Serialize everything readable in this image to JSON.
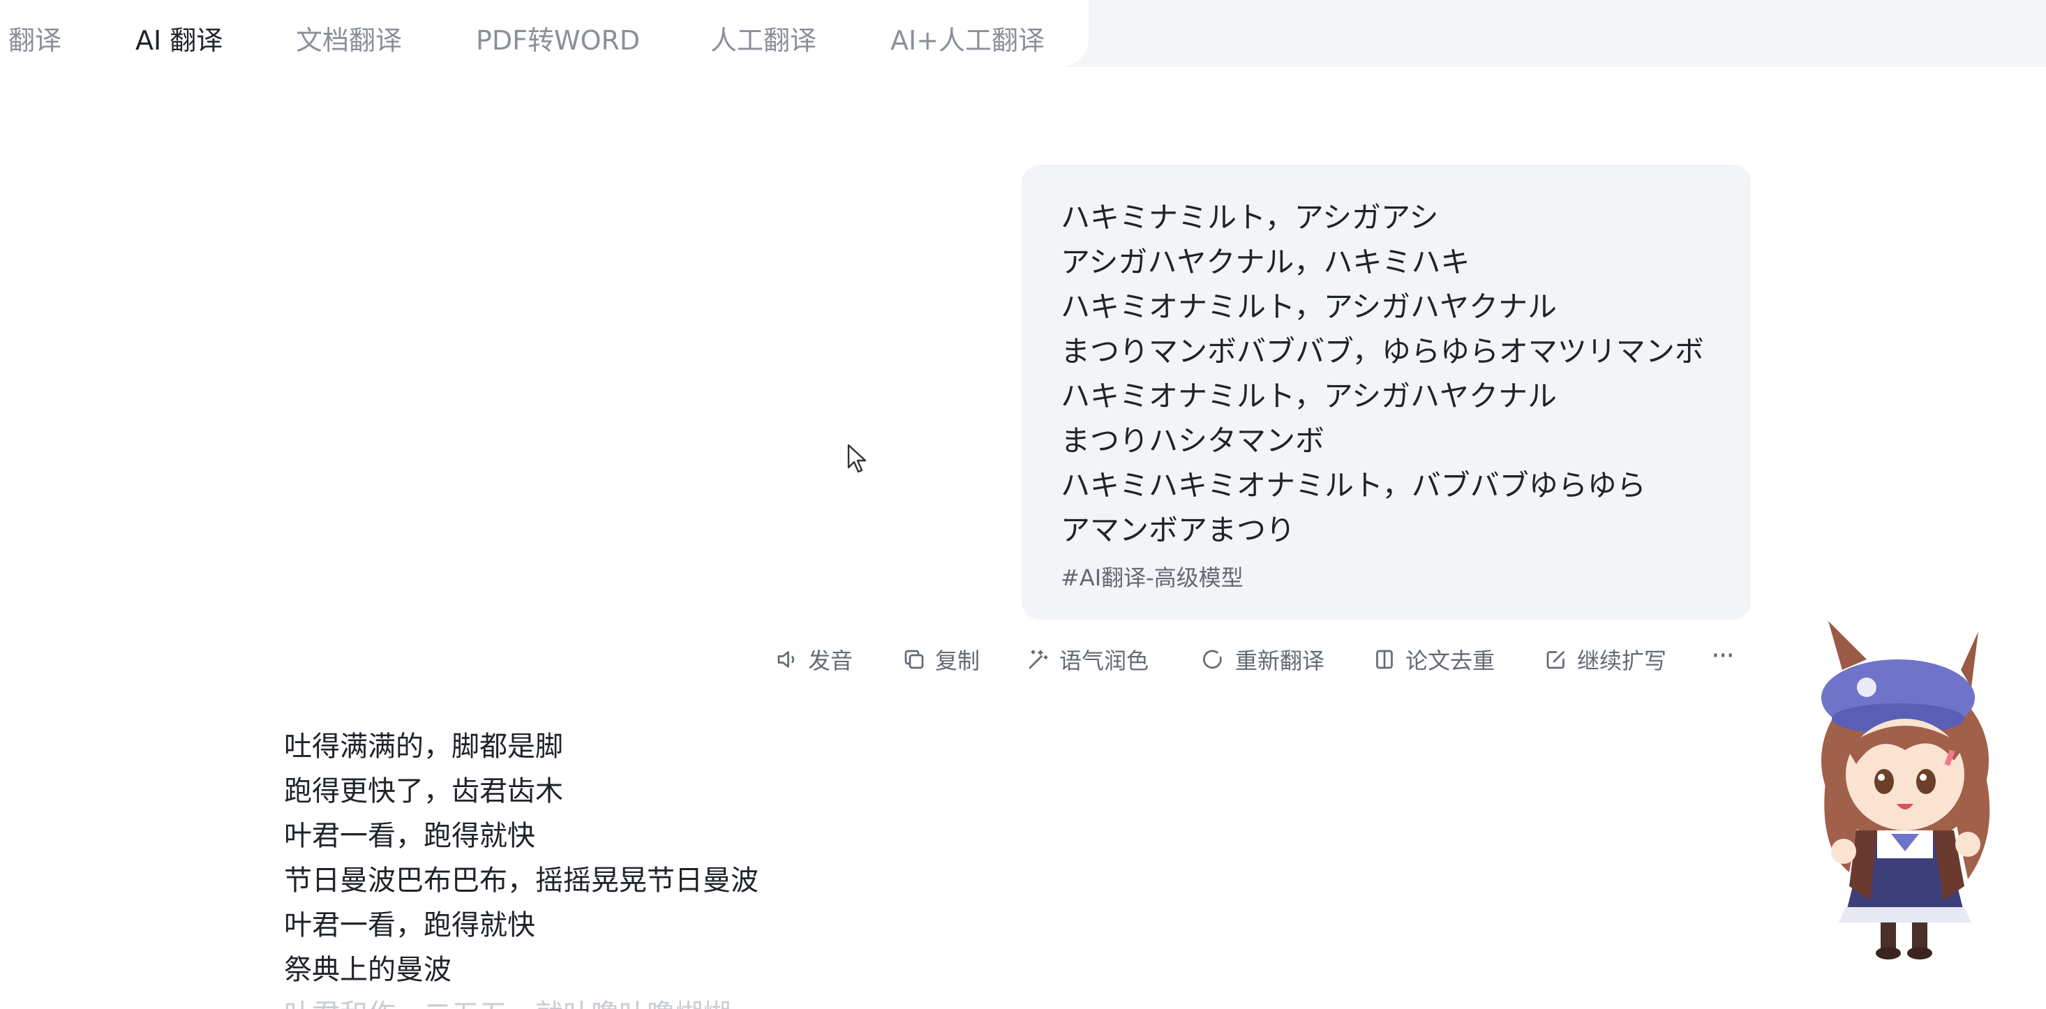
{
  "tabs": [
    {
      "label": "翻译",
      "active": false
    },
    {
      "label_prefix": "AI ",
      "label": "翻译",
      "active": true
    },
    {
      "label": "文档翻译",
      "active": false
    },
    {
      "label": "PDF转WORD",
      "active": false
    },
    {
      "label": "人工翻译",
      "active": false
    },
    {
      "label": "AI+人工翻译",
      "active": false
    }
  ],
  "source": {
    "lines": [
      "ハキミナミルト，アシガアシ",
      "アシガハヤクナル，ハキミハキ",
      "ハキミオナミルト，アシガハヤクナル",
      "まつりマンボバブバブ，ゆらゆらオマツリマンボ",
      "ハキミオナミルト，アシガハヤクナル",
      "まつりハシタマンボ",
      "ハキミハキミオナミルト，バブバブゆらゆら",
      "アマンボアまつり"
    ],
    "model_tag": "#AI翻译-高级模型"
  },
  "toolbar": {
    "speak": "发音",
    "copy": "复制",
    "polish": "语气润色",
    "retranslate": "重新翻译",
    "dedupe": "论文去重",
    "expand": "继续扩写",
    "more": "···"
  },
  "output": {
    "lines": [
      "吐得满满的，脚都是脚",
      "跑得更快了，齿君齿木",
      "叶君一看，跑得就快",
      "节日曼波巴布巴布，摇摇晃晃节日曼波",
      "叶君一看，跑得就快",
      "祭典上的曼波"
    ],
    "partial_line": "叶君和作，二五五，就叶噜叶噜煳煳"
  },
  "colors": {
    "accent": "#4e7cf6",
    "bubble_bg": "#f3f4f8",
    "muted_text": "#646a73",
    "tab_inactive": "#8a8f99"
  }
}
